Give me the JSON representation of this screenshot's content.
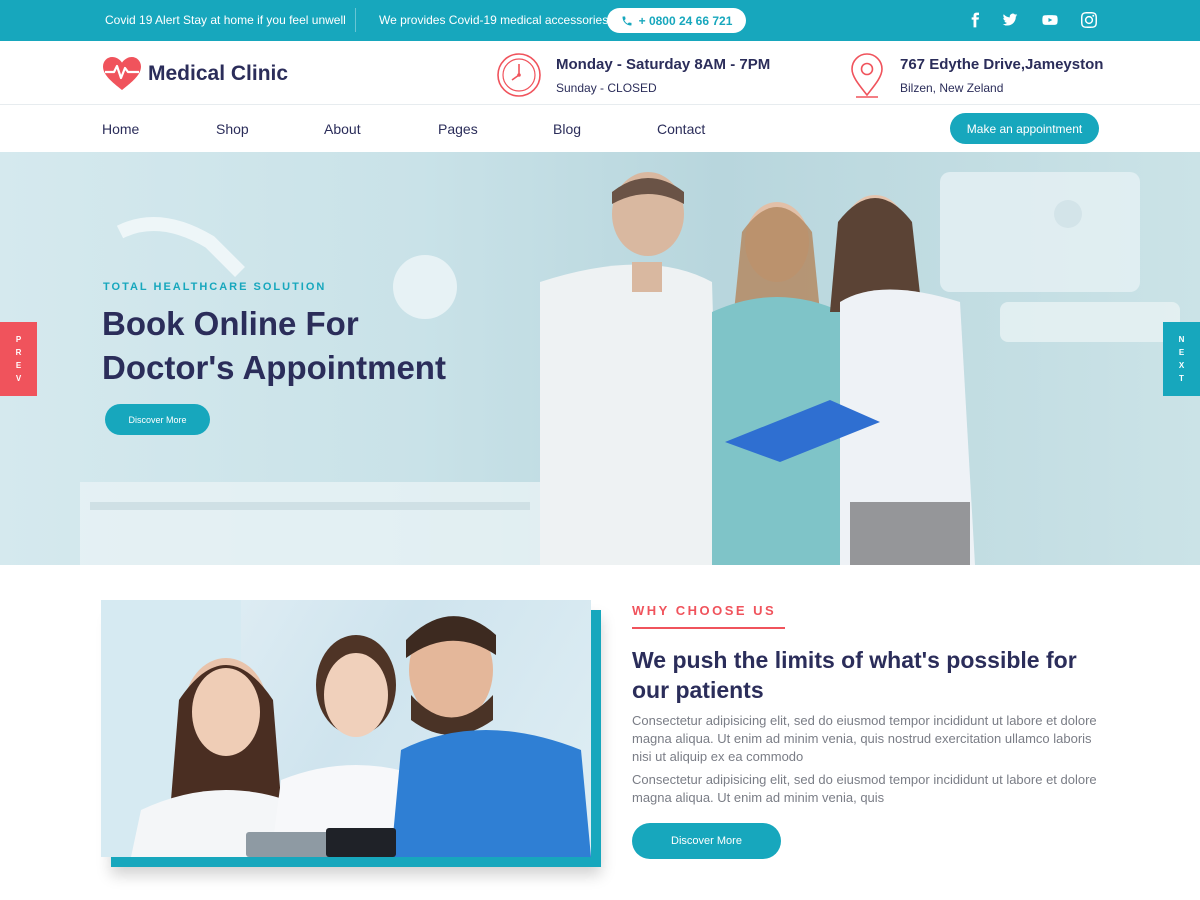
{
  "topbar": {
    "alert_text": "Covid 19 Alert Stay at home if you feel unwell",
    "covid_text": "We provides Covid-19 medical accessories",
    "phone": "+ 0800 24 66 721",
    "social": [
      "facebook-icon",
      "twitter-icon",
      "youtube-icon",
      "instagram-icon"
    ]
  },
  "header": {
    "logo_name": "Medical Clinic",
    "hours_title": "Monday - Saturday  8AM - 7PM",
    "hours_sub": "Sunday - CLOSED",
    "address_title": "767 Edythe Drive,Jameyston",
    "address_sub": "Bilzen, New Zeland"
  },
  "nav": {
    "items": [
      "Home",
      "Shop",
      "About",
      "Pages",
      "Blog",
      "Contact"
    ],
    "cta": "Make an appointment"
  },
  "hero": {
    "eyebrow": "TOTAL HEALTHCARE SOLUTION",
    "title_line1": "Book Online For",
    "title_line2": "Doctor's Appointment",
    "button": "Discover More",
    "prev_letters": [
      "P",
      "R",
      "E",
      "V"
    ],
    "next_letters": [
      "N",
      "E",
      "X",
      "T"
    ]
  },
  "why": {
    "eyebrow": "WHY CHOOSE US",
    "title": "We push the limits of what's possible for our patients",
    "paragraph1": "Consectetur adipisicing elit, sed do eiusmod tempor incididunt ut labore et dolore magna aliqua. Ut enim ad minim venia, quis nostrud exercitation ullamco laboris nisi ut aliquip ex ea commodo",
    "paragraph2": "Consectetur adipisicing elit, sed do eiusmod tempor incididunt ut labore et dolore magna aliqua. Ut enim ad minim venia, quis",
    "button": "Discover More"
  },
  "colors": {
    "primary": "#17a7bd",
    "accent": "#f0535c",
    "heading": "#2b2d5a",
    "body_text": "#7a7d86"
  }
}
